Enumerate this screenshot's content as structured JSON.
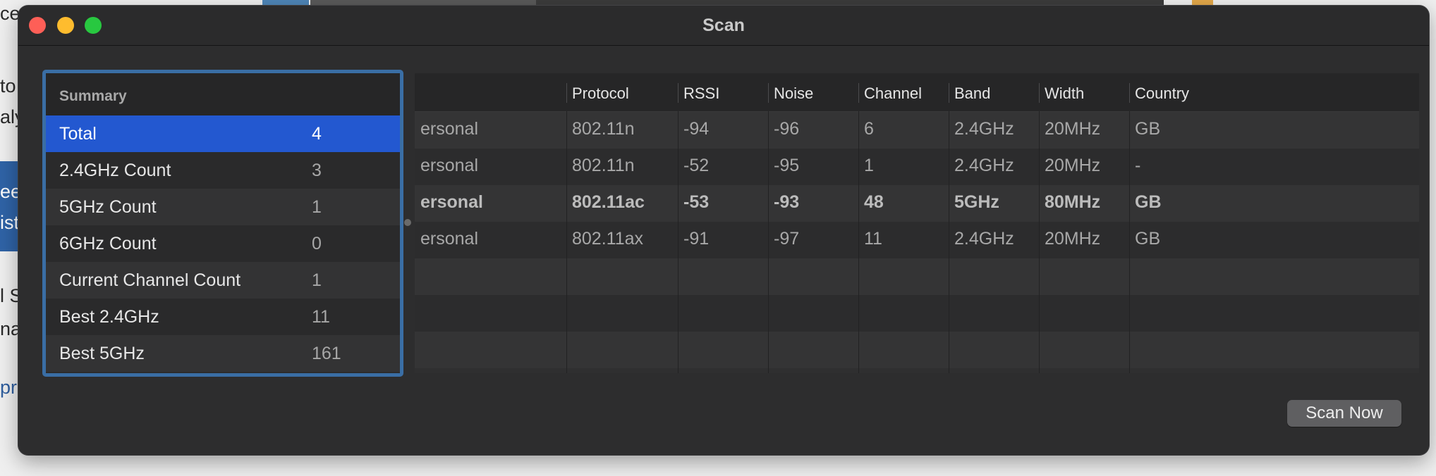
{
  "background": {
    "fragments": [
      "ces",
      "to",
      "aly",
      "ee",
      "ist",
      "l S",
      "na",
      "pro"
    ]
  },
  "window": {
    "title": "Scan",
    "controls": [
      "close",
      "minimize",
      "zoom"
    ]
  },
  "summary": {
    "header": "Summary",
    "selected_index": 0,
    "rows": [
      {
        "label": "Total",
        "value": "4"
      },
      {
        "label": "2.4GHz Count",
        "value": "3"
      },
      {
        "label": "5GHz Count",
        "value": "1"
      },
      {
        "label": "6GHz Count",
        "value": "0"
      },
      {
        "label": "Current Channel Count",
        "value": "1"
      },
      {
        "label": "Best 2.4GHz",
        "value": "11"
      },
      {
        "label": "Best 5GHz",
        "value": "161"
      }
    ]
  },
  "networks": {
    "columns": [
      "",
      "Protocol",
      "RSSI",
      "Noise",
      "Channel",
      "Band",
      "Width",
      "Country"
    ],
    "rows": [
      {
        "security": "ersonal",
        "protocol": "802.11n",
        "rssi": "-94",
        "noise": "-96",
        "channel": "6",
        "band": "2.4GHz",
        "width": "20MHz",
        "country": "GB",
        "current": false
      },
      {
        "security": "ersonal",
        "protocol": "802.11n",
        "rssi": "-52",
        "noise": "-95",
        "channel": "1",
        "band": "2.4GHz",
        "width": "20MHz",
        "country": "-",
        "current": false
      },
      {
        "security": "ersonal",
        "protocol": "802.11ac",
        "rssi": "-53",
        "noise": "-93",
        "channel": "48",
        "band": "5GHz",
        "width": "80MHz",
        "country": "GB",
        "current": true
      },
      {
        "security": "ersonal",
        "protocol": "802.11ax",
        "rssi": "-91",
        "noise": "-97",
        "channel": "11",
        "band": "2.4GHz",
        "width": "20MHz",
        "country": "GB",
        "current": false
      }
    ],
    "empty_rows": 3
  },
  "actions": {
    "scan_now": "Scan Now"
  }
}
